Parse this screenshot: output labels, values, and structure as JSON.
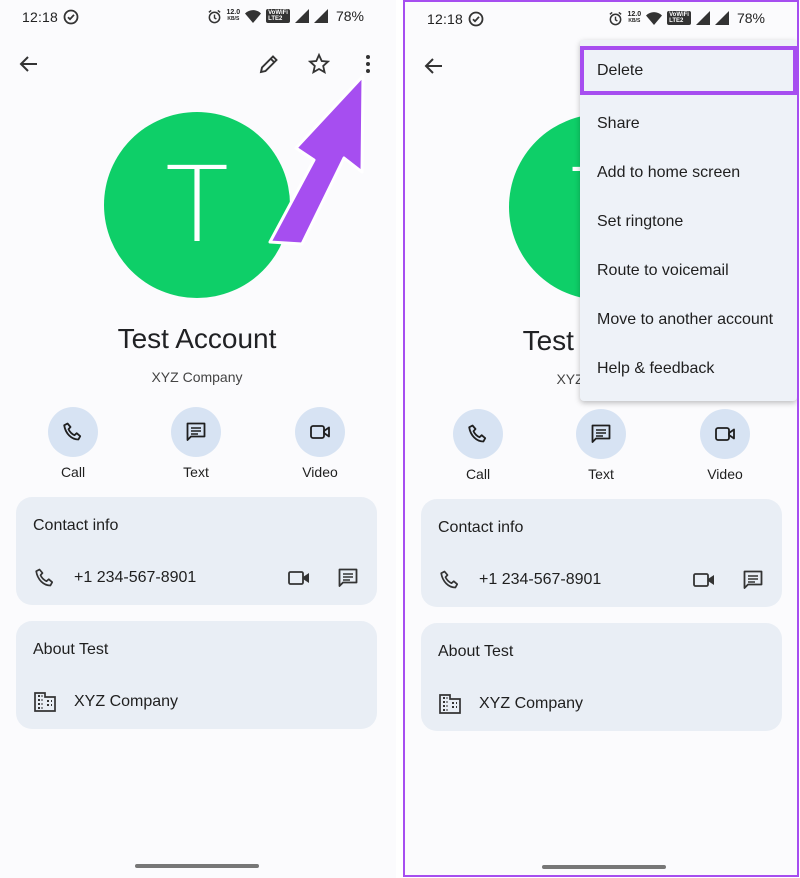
{
  "status": {
    "time": "12:18",
    "net_speed_top": "12.0",
    "net_speed_unit": "KB/S",
    "volte_top": "VoWiFi",
    "volte_bottom": "LTE2",
    "battery": "78%"
  },
  "contact": {
    "initial": "T",
    "name": "Test Account",
    "company": "XYZ Company"
  },
  "actions": {
    "call": "Call",
    "text": "Text",
    "video": "Video"
  },
  "contact_info": {
    "title": "Contact info",
    "phone": "+1 234-567-8901"
  },
  "about": {
    "title": "About Test",
    "company": "XYZ Company"
  },
  "menu": {
    "items": [
      "Delete",
      "Share",
      "Add to home screen",
      "Set ringtone",
      "Route to voicemail",
      "Move to another account",
      "Help & feedback"
    ]
  },
  "colors": {
    "avatar": "#0ecf68",
    "accent_highlight": "#a64ef0",
    "card_bg": "#e9eef5",
    "action_circle": "#d7e3f3"
  }
}
